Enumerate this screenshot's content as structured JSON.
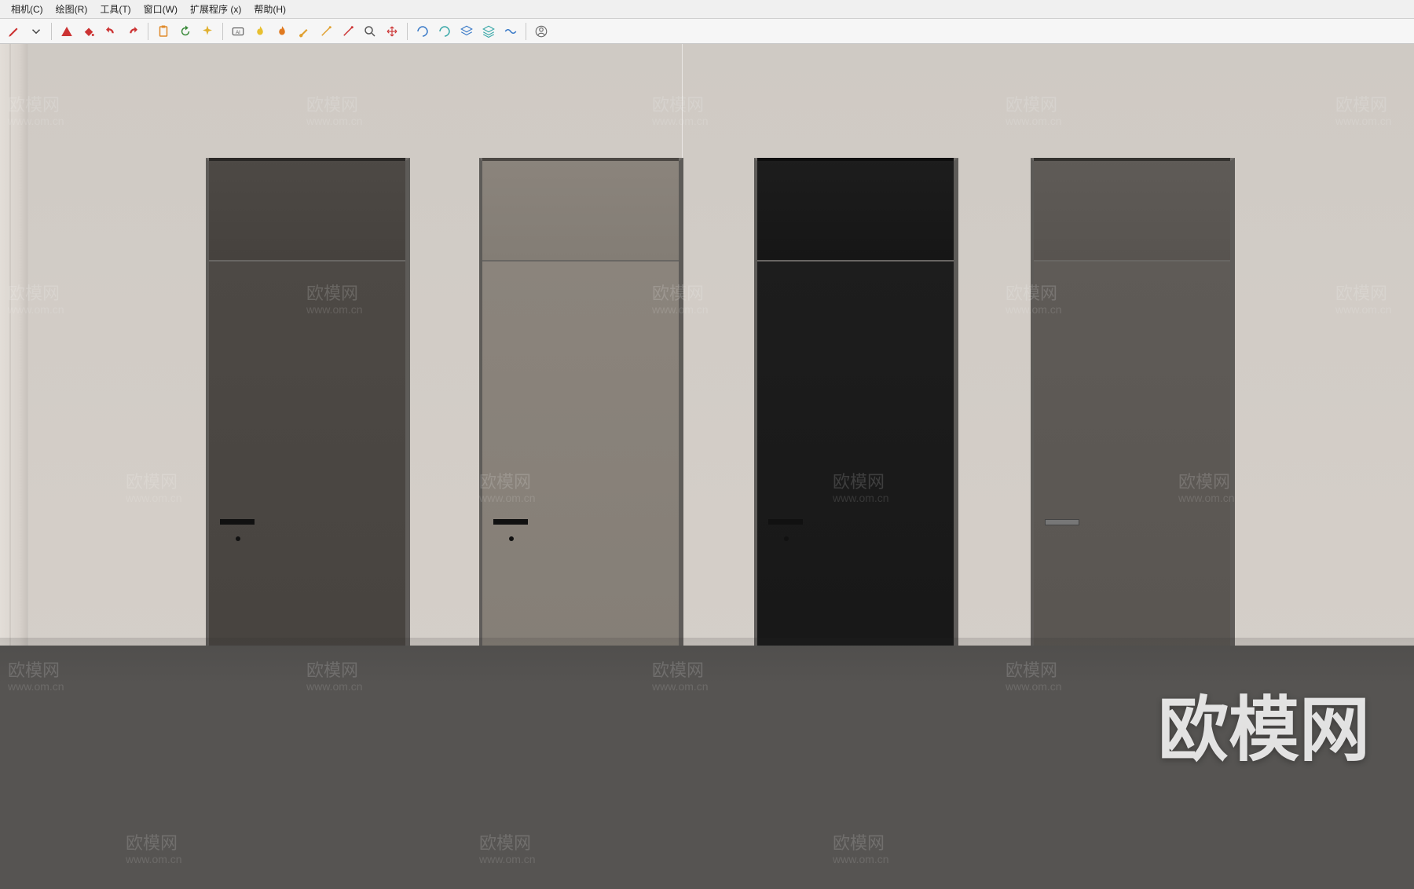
{
  "menu": {
    "camera": "相机(C)",
    "draw": "绘图(R)",
    "tools": "工具(T)",
    "window": "窗口(W)",
    "extensions": "扩展程序 (x)",
    "help": "帮助(H)"
  },
  "toolbar_icons": {
    "pencil": "pencil-icon",
    "triangle": "triangle-icon",
    "bucket": "paint-bucket-icon",
    "undo": "undo-icon",
    "redo": "redo-icon",
    "clipboard": "clipboard-icon",
    "refresh": "refresh-icon",
    "sparkle": "sparkle-icon",
    "ai": "ai-icon",
    "flame_y": "flame-yellow-icon",
    "flame_o": "flame-orange-icon",
    "brush": "brush-icon",
    "wand": "wand-icon",
    "wand_red": "wand-red-icon",
    "search": "magnifier-icon",
    "arrows": "arrows-out-icon",
    "swirl1": "swirl-blue-icon",
    "swirl2": "swirl-teal-icon",
    "stack": "stack-icon",
    "layers": "layers-icon",
    "wave": "wave-icon",
    "user": "user-circle-icon"
  },
  "watermark": {
    "cn": "欧模网",
    "en": "www.om.cn"
  },
  "scene": {
    "doors": [
      {
        "id": "door-1",
        "color": "dark-brown"
      },
      {
        "id": "door-2",
        "color": "warm-gray"
      },
      {
        "id": "door-3",
        "color": "black"
      },
      {
        "id": "door-4",
        "color": "cool-gray"
      }
    ]
  }
}
